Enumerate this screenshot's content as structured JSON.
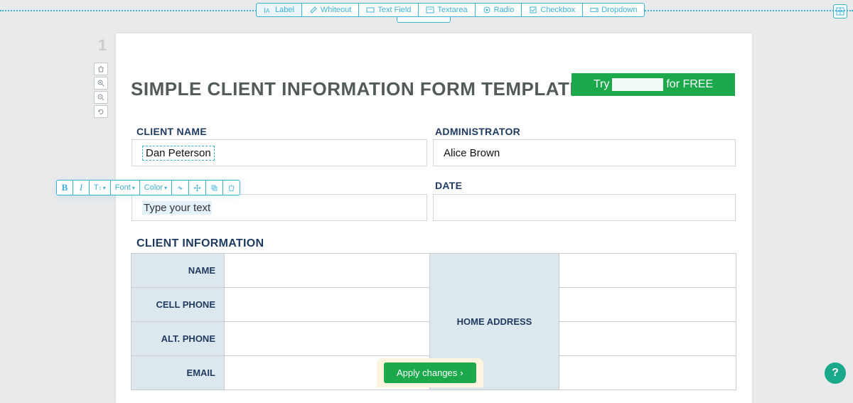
{
  "toolbar": {
    "items": [
      {
        "label": "Label",
        "icon": "label-icon",
        "active": true
      },
      {
        "label": "Whiteout",
        "icon": "whiteout-icon",
        "active": false
      },
      {
        "label": "Text Field",
        "icon": "textfield-icon",
        "active": false
      },
      {
        "label": "Textarea",
        "icon": "textarea-icon",
        "active": false
      },
      {
        "label": "Radio",
        "icon": "radio-icon",
        "active": false
      },
      {
        "label": "Checkbox",
        "icon": "checkbox-icon",
        "active": false
      },
      {
        "label": "Dropdown",
        "icon": "dropdown-icon",
        "active": false
      }
    ]
  },
  "page_number": "1",
  "side_tools": [
    "delete",
    "zoom-in",
    "zoom-out",
    "refresh"
  ],
  "document": {
    "title": "SIMPLE CLIENT INFORMATION FORM TEMPLATE",
    "cta_prefix": "Try",
    "cta_suffix": "for FREE",
    "fields": {
      "client_name_label": "CLIENT NAME",
      "client_name_value": "Dan Peterson",
      "administrator_label": "ADMINISTRATOR",
      "administrator_value": "Alice Brown",
      "date_label": "DATE",
      "date_value": "",
      "placeholder_label": "Type your text"
    },
    "section_title": "CLIENT INFORMATION",
    "table": {
      "rows": [
        "NAME",
        "CELL PHONE",
        "ALT. PHONE",
        "EMAIL"
      ],
      "right_label": "HOME ADDRESS"
    }
  },
  "format_toolbar": {
    "bold": "B",
    "italic": "I",
    "size": "T",
    "font": "Font",
    "color": "Color",
    "link": "link",
    "move": "move",
    "copy": "copy",
    "delete": "delete"
  },
  "apply_button": "Apply changes",
  "help": "?"
}
